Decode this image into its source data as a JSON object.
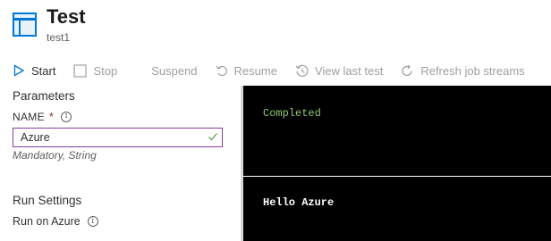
{
  "header": {
    "icon": "runbook-test-pane-icon",
    "title": "Test",
    "subtitle": "test1"
  },
  "toolbar": {
    "items": [
      {
        "label": "Start",
        "icon": "play-icon",
        "enabled": true
      },
      {
        "label": "Stop",
        "icon": "stop-icon",
        "enabled": false
      },
      {
        "label": "Suspend",
        "icon": "",
        "enabled": false
      },
      {
        "label": "Resume",
        "icon": "resume-icon",
        "enabled": false
      },
      {
        "label": "View last test",
        "icon": "history-icon",
        "enabled": false
      },
      {
        "label": "Refresh job streams",
        "icon": "refresh-icon",
        "enabled": false
      }
    ]
  },
  "parameters": {
    "section_title": "Parameters",
    "name_label": "NAME",
    "required_marker": "*",
    "name_value": "Azure",
    "name_hint": "Mandatory, String"
  },
  "run_settings": {
    "section_title": "Run Settings",
    "option_label": "Run on Azure"
  },
  "console": {
    "status": "Completed",
    "output": "Hello Azure"
  },
  "colors": {
    "accent": "#0078d4",
    "input_border": "#8a3b9e",
    "status_text": "#90c870",
    "console_bg": "#000000",
    "required": "#a4262c"
  }
}
